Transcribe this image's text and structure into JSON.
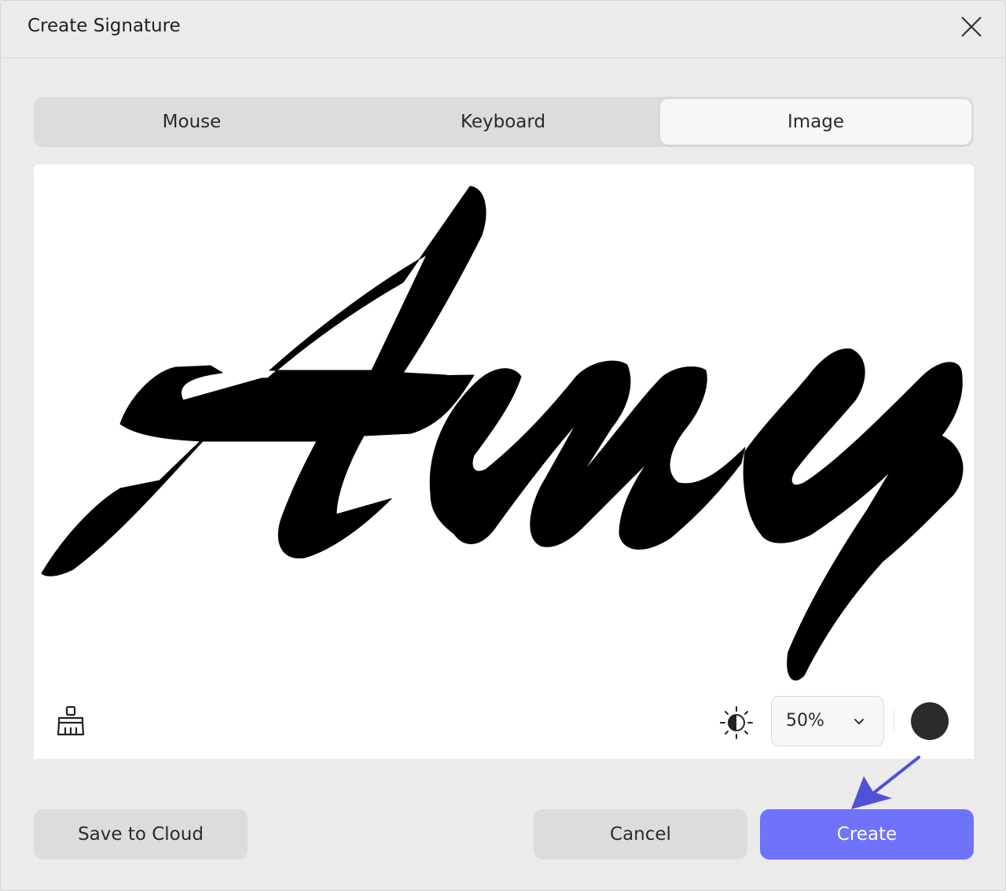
{
  "dialog": {
    "title": "Create Signature",
    "close_icon": "close-icon"
  },
  "tabs": [
    {
      "label": "Mouse",
      "selected": false
    },
    {
      "label": "Keyboard",
      "selected": false
    },
    {
      "label": "Image",
      "selected": true
    }
  ],
  "canvas": {
    "signature_text": "Amy",
    "clear_icon": "broom-icon",
    "contrast_icon": "contrast-icon",
    "contrast_value": "50%",
    "ink_color": "#2b2b2b"
  },
  "footer": {
    "save_label": "Save to Cloud",
    "cancel_label": "Cancel",
    "create_label": "Create"
  },
  "colors": {
    "accent": "#6f73fc",
    "annotation_arrow": "#4f52d6"
  }
}
